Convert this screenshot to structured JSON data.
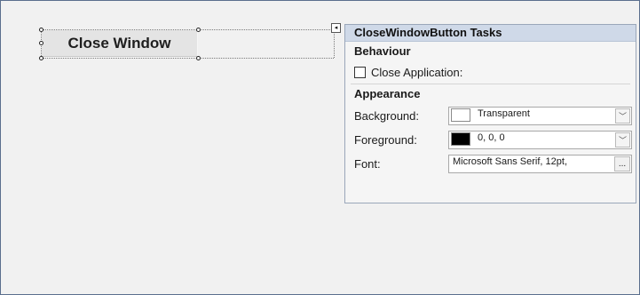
{
  "form": {
    "button_text": "Close Window"
  },
  "smart_tag": {
    "icon": "smart-tag-arrow-icon",
    "glyph": "◂"
  },
  "panel": {
    "title": "CloseWindowButton Tasks",
    "behaviour": {
      "title": "Behaviour",
      "close_application_label": "Close Application:",
      "close_application_checked": false
    },
    "appearance": {
      "title": "Appearance",
      "background_label": "Background:",
      "background_value": "Transparent",
      "background_color": "#ffffff",
      "foreground_label": "Foreground:",
      "foreground_value": "0, 0, 0",
      "foreground_color": "#000000",
      "font_label": "Font:",
      "font_value": "Microsoft Sans Serif, 12pt, ",
      "dropdown_glyph": "﹀",
      "ellipsis_glyph": "..."
    }
  },
  "colors": {
    "header_bg": "#cfd9e8",
    "surface_bg": "#f1f1f1",
    "frame_border": "#5b6f8d"
  }
}
